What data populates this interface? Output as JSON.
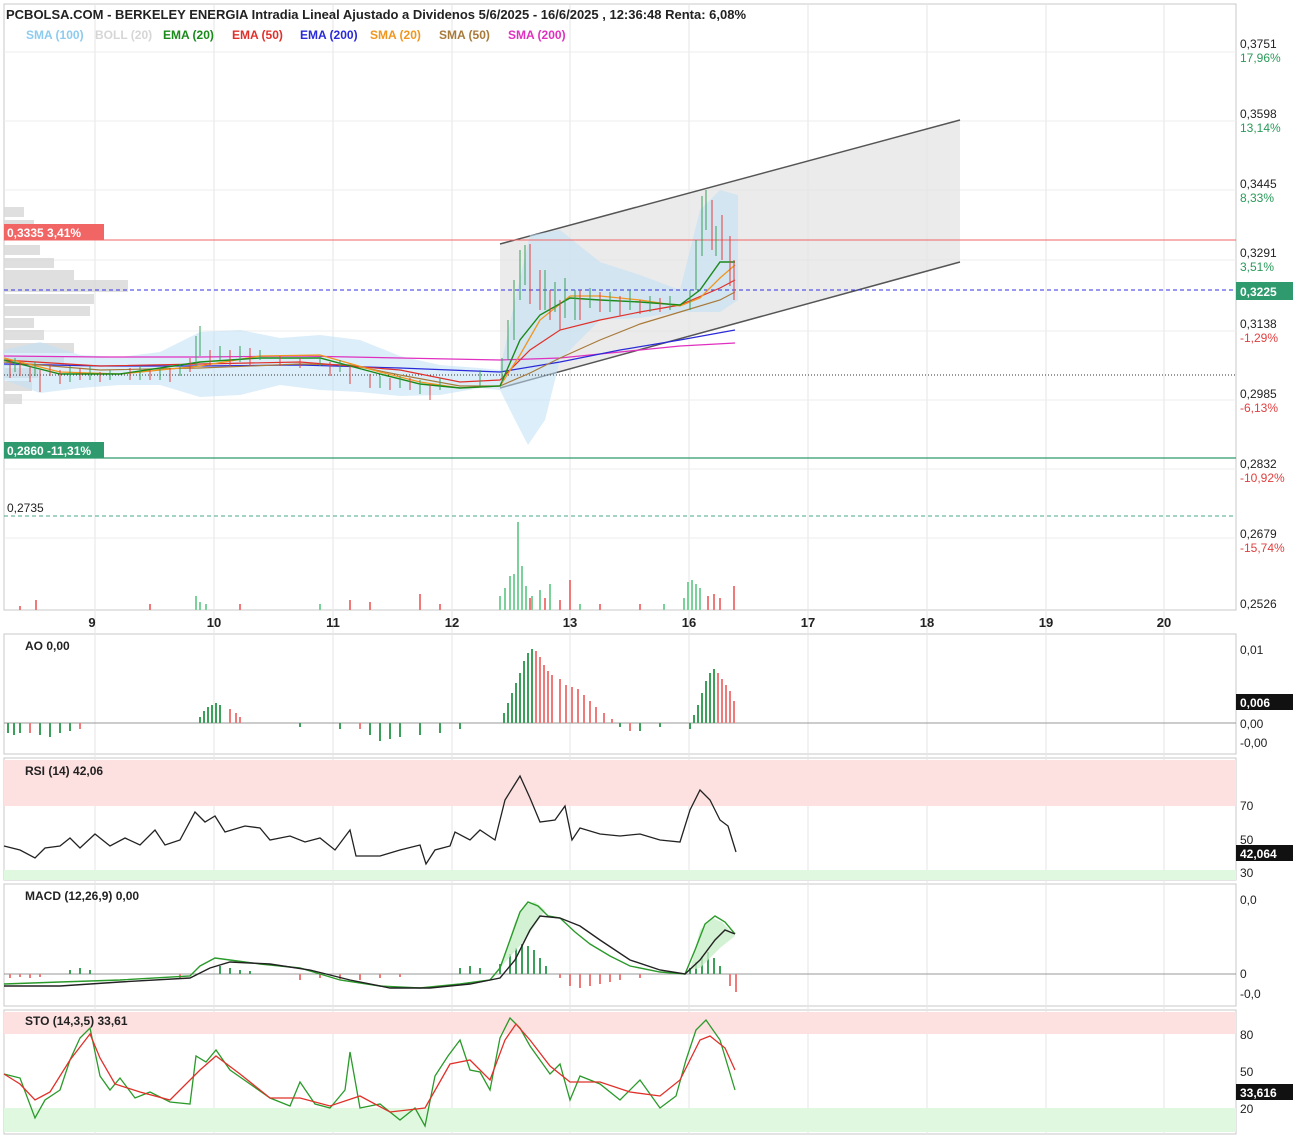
{
  "title": "PCBOLSA.COM - BERKELEY ENERGIA Intradia Lineal Ajustado a Dividenos 5/6/2025 - 16/6/2025 , 12:36:48 Renta: 6,08%",
  "legend": [
    {
      "label": "SMA (100)",
      "color": "#8ecbef"
    },
    {
      "label": "BOLL (20)",
      "color": "#d6d6d6"
    },
    {
      "label": "EMA (20)",
      "color": "#1a8a1a"
    },
    {
      "label": "EMA (50)",
      "color": "#e0302a"
    },
    {
      "label": "EMA (200)",
      "color": "#2a2ad8"
    },
    {
      "label": "SMA (20)",
      "color": "#f0961e"
    },
    {
      "label": "SMA (50)",
      "color": "#a87a3a"
    },
    {
      "label": "SMA (200)",
      "color": "#e030c0"
    }
  ],
  "price_axis": [
    {
      "value": "0,3751",
      "pct": "17,96%",
      "pct_color": "#2a9a5a"
    },
    {
      "value": "0,3598",
      "pct": "13,14%",
      "pct_color": "#2a9a5a"
    },
    {
      "value": "0,3445",
      "pct": "8,33%",
      "pct_color": "#2a9a5a"
    },
    {
      "value": "0,3291",
      "pct": "3,51%",
      "pct_color": "#2a9a5a"
    },
    {
      "value": "0,3138",
      "pct": "-1,29%",
      "pct_color": "#e04040"
    },
    {
      "value": "0,2985",
      "pct": "-6,13%",
      "pct_color": "#e04040"
    },
    {
      "value": "0,2832",
      "pct": "-10,92%",
      "pct_color": "#e04040"
    },
    {
      "value": "0,2679",
      "pct": "-15,74%",
      "pct_color": "#e04040"
    },
    {
      "value": "0,2526",
      "pct": "",
      "pct_color": "#e04040"
    }
  ],
  "price_range": [
    0.2526,
    0.3751
  ],
  "current_price_label": "0,3225",
  "current_price": 0.3225,
  "reference_price": 0.3018,
  "resistance": {
    "label": "0,3335  3,41%",
    "value": 0.3335,
    "color": "#f26565"
  },
  "support": {
    "label": "0,2860  -11,31%",
    "value": 0.286,
    "color": "#2e9a6e"
  },
  "low_level": {
    "label": "0,2735",
    "value": 0.2735,
    "color": "#4aa88a"
  },
  "x_days": [
    "9",
    "10",
    "11",
    "12",
    "13",
    "16",
    "17",
    "18",
    "19",
    "20"
  ],
  "panes": {
    "ao": {
      "label": "AO",
      "value": "0,00",
      "axis": [
        "0,01",
        "0,00",
        "-0,00"
      ],
      "tag": "0,006"
    },
    "rsi": {
      "label": "RSI (14)",
      "value": "42,06",
      "axis": [
        "70",
        "50",
        "30"
      ],
      "tag": "42,064"
    },
    "macd": {
      "label": "MACD (12,26,9)",
      "value": "0,00",
      "axis": [
        "0,0",
        "0",
        "-0,0"
      ]
    },
    "sto": {
      "label": "STO (14,3,5)",
      "value": "33,61",
      "axis": [
        "80",
        "50",
        "20"
      ],
      "tag": "33,616"
    }
  },
  "chart_data": [
    {
      "type": "line",
      "title": "BERKELEY ENERGIA Intradia",
      "x": [
        "9",
        "10",
        "11",
        "12",
        "12.5",
        "13",
        "16",
        "16.4"
      ],
      "series": [
        {
          "name": "",
          "values": [
            0.302,
            0.305,
            0.303,
            0.2995,
            0.33,
            0.325,
            0.341,
            0.3225
          ]
        }
      ],
      "channel": {
        "upper": [
          [
            0.3335,
            "12.4"
          ],
          [
            0.3616,
            "18.2"
          ]
        ],
        "lower": [
          [
            0.3005,
            "12.4"
          ],
          [
            0.3268,
            "18.2"
          ]
        ]
      },
      "ylim": [
        0.2526,
        0.3751
      ]
    }
  ]
}
